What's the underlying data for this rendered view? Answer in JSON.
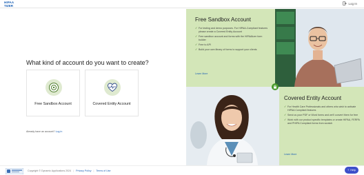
{
  "header": {
    "logo_line1": "HIPAA",
    "logo_line2": "TIZER",
    "login_label": "Log In"
  },
  "main": {
    "heading": "What kind of account do you want to create?",
    "cards": [
      {
        "label": "Free Sandbox Account",
        "icon": "sandbox-icon"
      },
      {
        "label": "Covered Entity Account",
        "icon": "heart-pulse-icon"
      }
    ],
    "already_text": "Already have an account?",
    "already_link": "Log in"
  },
  "sandbox_panel": {
    "title": "Free Sandbox Account",
    "bullets": [
      "For testing and demo purposes. For HIPAA-Compliant features please create a Covered Entity Account",
      "Free sandbox account and forms with the HIPAAtizer form builder",
      "Free to API",
      "Build your own library of forms to support your clients"
    ],
    "learn_more": "Learn More"
  },
  "covered_panel": {
    "title": "Covered Entity Account",
    "bullets": [
      "For Health Care Professionals and others who wish to activate HIPAA Compliant features",
      "Send us your PDF or Word forms and we'll convert them for free",
      "Work with our product specific templates or create HIPAA, FERPA and PHIPA Compliant forms from scratch"
    ],
    "learn_more": "Learn More"
  },
  "footer": {
    "copyright": "Copyright © Dynamic Applications 2024",
    "privacy": "Privacy Policy",
    "terms": "Terms of Use",
    "help_label": "Help"
  },
  "colors": {
    "accent_green": "#d3e6b8",
    "link_blue": "#1a5fb4",
    "help_button": "#3d4fc9"
  }
}
